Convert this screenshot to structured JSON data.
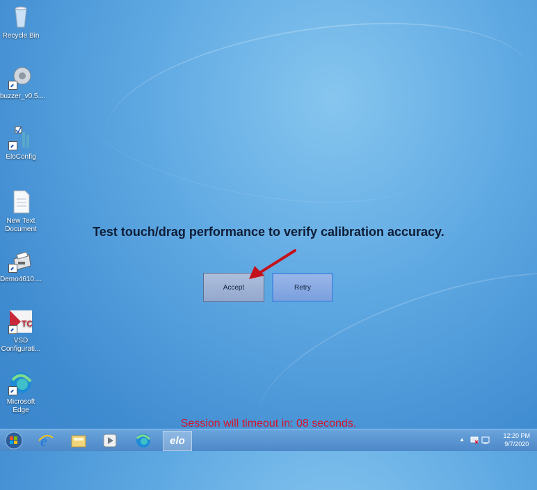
{
  "desktop": {
    "icons": [
      {
        "label": "Recycle Bin",
        "icon": "recycle-bin-icon"
      },
      {
        "label": "buzzer_v0.5....",
        "icon": "speaker-icon"
      },
      {
        "label": "EloConfig",
        "icon": "elo-config-icon"
      },
      {
        "label": "New Text Document",
        "icon": "text-document-icon"
      },
      {
        "label": "Demo4610....",
        "icon": "printer-icon"
      },
      {
        "label": "VSD Configurati...",
        "icon": "vsd-config-icon"
      },
      {
        "label": "Microsoft Edge",
        "icon": "edge-icon"
      }
    ]
  },
  "dialog": {
    "message": "Test touch/drag performance to verify calibration accuracy.",
    "accept_label": "Accept",
    "retry_label": "Retry",
    "timeout_text": "Session will timeout in: 08 seconds.",
    "annotation": "red-arrow-icon"
  },
  "taskbar": {
    "items": [
      "start-button",
      "internet-explorer-icon",
      "file-explorer-icon",
      "media-player-icon",
      "edge-icon",
      "elo-icon"
    ],
    "elo_label": "elo",
    "clock": {
      "time": "12:20 PM",
      "date": "9/7/2020"
    }
  },
  "colors": {
    "timeout": "#d4142d",
    "message": "#0f1d36",
    "accent": "#4a8fe0"
  }
}
